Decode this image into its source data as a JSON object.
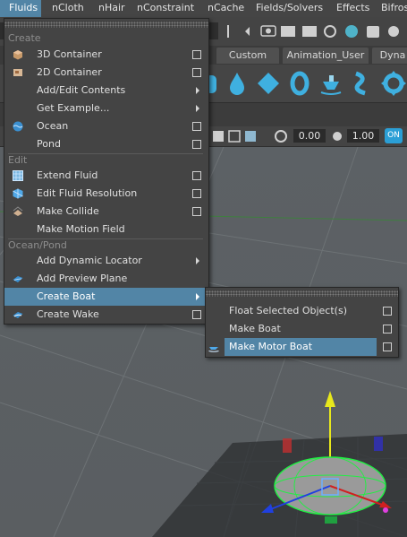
{
  "menubar": {
    "items": [
      "Fluids",
      "nCloth",
      "nHair",
      "nConstraint",
      "nCache",
      "Fields/Solvers",
      "Effects",
      "Bifros"
    ]
  },
  "shelf": {
    "tabs": [
      "Custom",
      "Animation_User",
      "Dyna"
    ],
    "icons": [
      "fluid-container-icon",
      "droplet-icon",
      "diamond-icon",
      "ring-icon",
      "boat-icon",
      "wave-icon",
      "lifebuoy-icon"
    ]
  },
  "toolbar": {
    "value_a": "0.00",
    "value_b": "1.00",
    "toggle": "ON"
  },
  "fluids_menu": {
    "sections": {
      "create": "Create",
      "edit": "Edit",
      "ocean_pond": "Ocean/Pond"
    },
    "items": [
      {
        "label": "3D Container",
        "option_box": true,
        "submenu": false,
        "icon": "cube-3d-icon"
      },
      {
        "label": "2D Container",
        "option_box": true,
        "submenu": false,
        "icon": "square-2d-icon"
      },
      {
        "label": "Add/Edit Contents",
        "option_box": false,
        "submenu": true,
        "icon": ""
      },
      {
        "label": "Get Example...",
        "option_box": false,
        "submenu": true,
        "icon": ""
      },
      {
        "label": "Ocean",
        "option_box": true,
        "submenu": false,
        "icon": "ocean-icon"
      },
      {
        "label": "Pond",
        "option_box": true,
        "submenu": false,
        "icon": ""
      },
      {
        "label": "Extend Fluid",
        "option_box": true,
        "submenu": false,
        "icon": "grid-icon"
      },
      {
        "label": "Edit Fluid Resolution",
        "option_box": true,
        "submenu": false,
        "icon": "resolution-icon"
      },
      {
        "label": "Make Collide",
        "option_box": true,
        "submenu": false,
        "icon": "collide-icon"
      },
      {
        "label": "Make Motion Field",
        "option_box": false,
        "submenu": false,
        "icon": ""
      },
      {
        "label": "Add Dynamic Locator",
        "option_box": false,
        "submenu": true,
        "icon": ""
      },
      {
        "label": "Add Preview Plane",
        "option_box": false,
        "submenu": false,
        "icon": "plane-icon"
      },
      {
        "label": "Create Boat",
        "option_box": false,
        "submenu": true,
        "icon": ""
      },
      {
        "label": "Create Wake",
        "option_box": true,
        "submenu": false,
        "icon": "wake-icon"
      }
    ]
  },
  "boat_submenu": {
    "items": [
      {
        "label": "Float Selected Object(s)",
        "option_box": true
      },
      {
        "label": "Make Boat",
        "option_box": true
      },
      {
        "label": "Make Motor Boat",
        "option_box": true
      }
    ]
  },
  "colors": {
    "highlight": "#5285a6",
    "menu_bg": "#444444",
    "viewport_bg": "#5b6063"
  }
}
